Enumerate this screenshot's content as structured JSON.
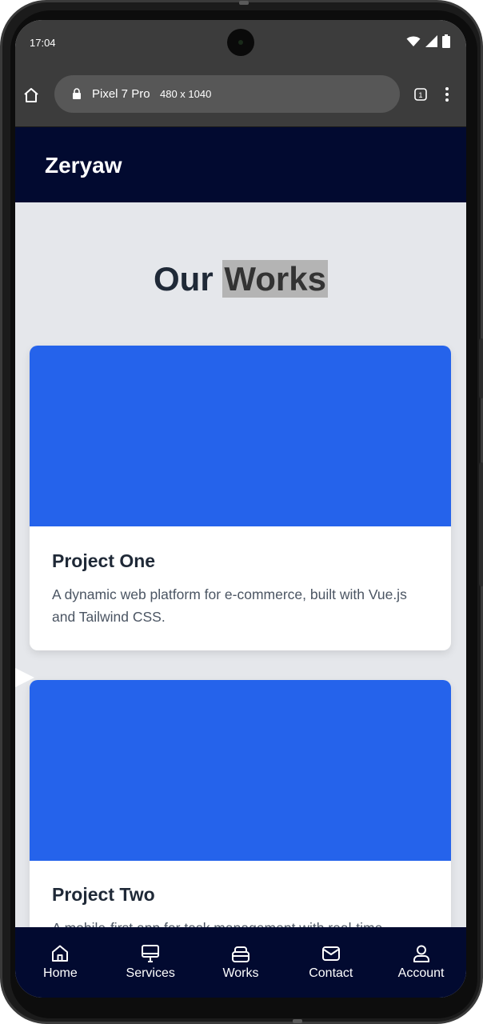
{
  "status_bar": {
    "time": "17:04",
    "icons": [
      "wifi-icon",
      "signal-icon",
      "battery-icon"
    ]
  },
  "browser": {
    "url_title": "Pixel 7 Pro",
    "url_dims": "480 x 1040",
    "tab_count": "1",
    "icons": [
      "home-icon",
      "lock-icon",
      "tabs-icon",
      "menu-dots-icon"
    ]
  },
  "header": {
    "brand": "Zeryaw",
    "background": "#020a30"
  },
  "works": {
    "title_part1": "Our",
    "title_part2": "Works",
    "projects": [
      {
        "title": "Project One",
        "description": "A dynamic web platform for e-commerce, built with Vue.js and Tailwind CSS.",
        "image_color": "#2563eb"
      },
      {
        "title": "Project Two",
        "description": "A mobile-first app for task management with real-time",
        "image_color": "#2563eb"
      }
    ]
  },
  "nav": {
    "items": [
      {
        "label": "Home",
        "icon": "home-icon"
      },
      {
        "label": "Services",
        "icon": "monitor-icon"
      },
      {
        "label": "Works",
        "icon": "briefcase-icon"
      },
      {
        "label": "Contact",
        "icon": "mail-icon"
      },
      {
        "label": "Account",
        "icon": "user-icon"
      }
    ]
  },
  "colors": {
    "accent": "#2563eb",
    "page_bg": "#e5e7eb",
    "text_dark": "#1f2937",
    "text_muted": "#4b5563"
  }
}
